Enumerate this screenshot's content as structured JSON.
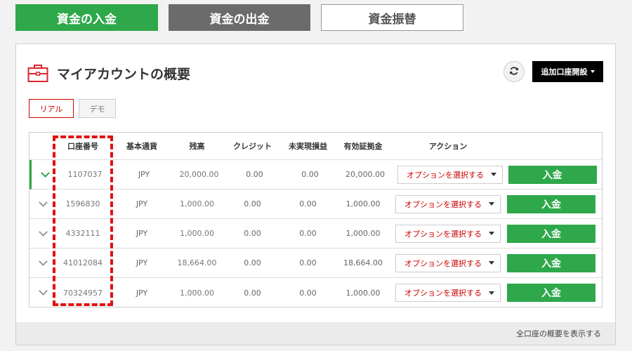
{
  "top_tabs": {
    "deposit": "資金の入金",
    "withdraw": "資金の出金",
    "transfer": "資金振替"
  },
  "card": {
    "title": "マイアカウントの概要",
    "add_account_label": "追加口座開設",
    "footer_link": "全口座の概要を表示する"
  },
  "mode_tabs": {
    "real": "リアル",
    "demo": "デモ"
  },
  "table": {
    "headers": [
      "口座番号",
      "基本通貨",
      "残高",
      "クレジット",
      "未実現損益",
      "有効証拠金",
      "アクション"
    ],
    "rows": [
      {
        "account": "1107037",
        "currency": "JPY",
        "balance": "20,000.00",
        "credit": "0.00",
        "unrealized": "0.00",
        "equity": "20,000.00"
      },
      {
        "account": "1596830",
        "currency": "JPY",
        "balance": "1,000.00",
        "credit": "0.00",
        "unrealized": "0.00",
        "equity": "1,000.00"
      },
      {
        "account": "4332111",
        "currency": "JPY",
        "balance": "1,000.00",
        "credit": "0.00",
        "unrealized": "0.00",
        "equity": "1,000.00"
      },
      {
        "account": "41012084",
        "currency": "JPY",
        "balance": "18,664.00",
        "credit": "0.00",
        "unrealized": "0.00",
        "equity": "18,664.00"
      },
      {
        "account": "70324957",
        "currency": "JPY",
        "balance": "1,000.00",
        "credit": "0.00",
        "unrealized": "0.00",
        "equity": "1,000.00"
      }
    ],
    "select_label": "オプションを選択する",
    "deposit_label": "入金"
  },
  "colors": {
    "accent_green": "#2ea84a",
    "accent_red": "#cc0000",
    "highlight_red": "#e01010"
  }
}
